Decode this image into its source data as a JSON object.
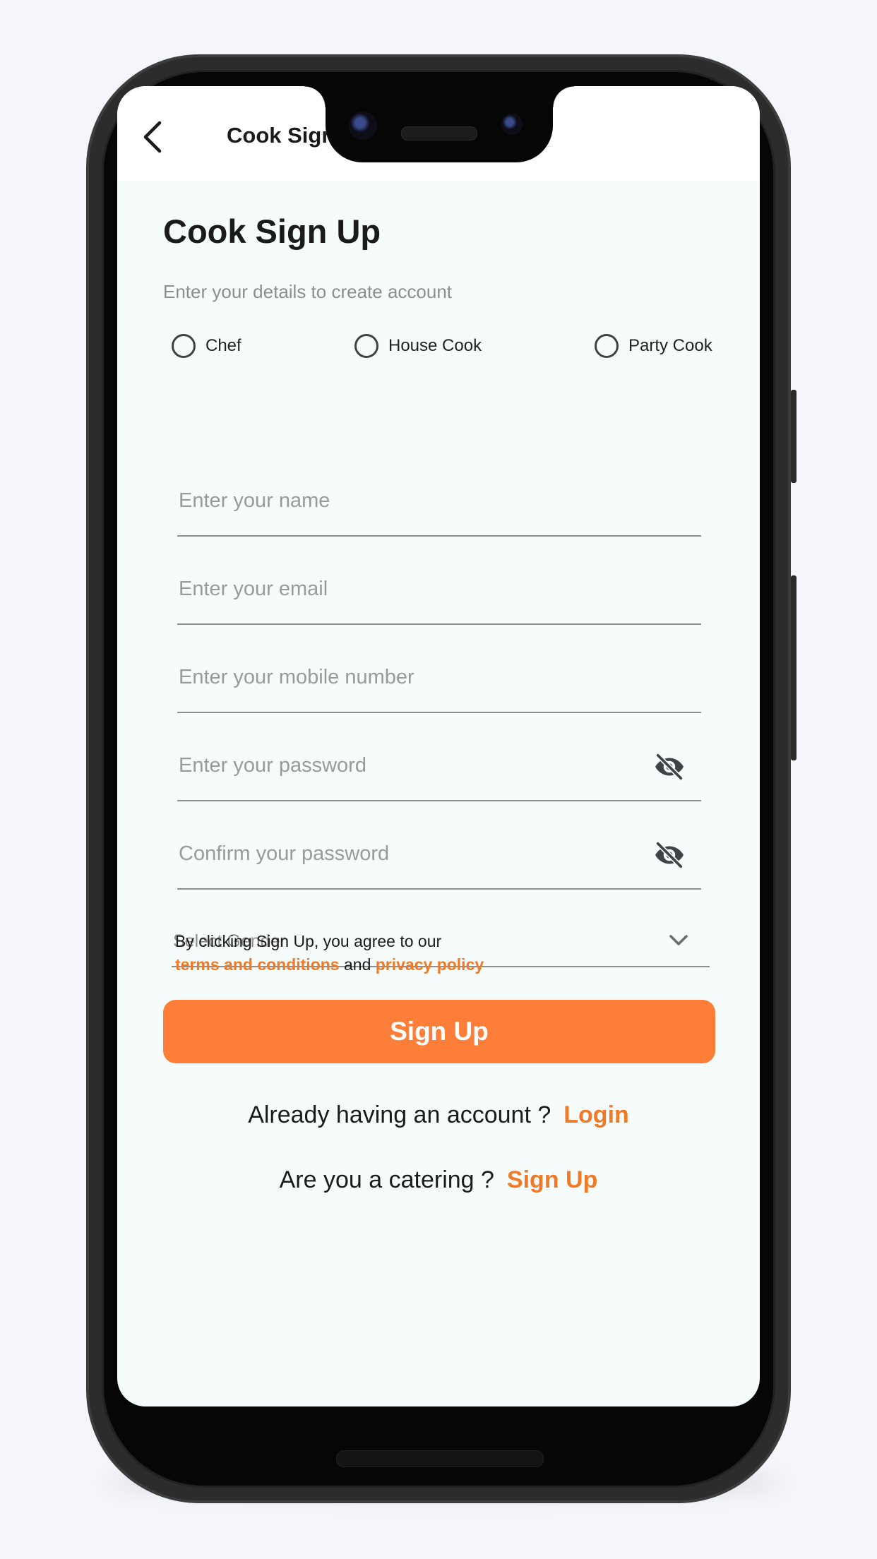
{
  "appbar": {
    "title": "Cook Sign Up",
    "back_icon": "chevron-left-icon"
  },
  "page": {
    "title": "Cook Sign Up",
    "subtitle": "Enter your details to create account"
  },
  "roles": [
    {
      "label": "Chef",
      "selected": false
    },
    {
      "label": "House Cook",
      "selected": false
    },
    {
      "label": "Party Cook",
      "selected": false
    }
  ],
  "fields": {
    "name": {
      "placeholder": "Enter your name",
      "value": ""
    },
    "email": {
      "placeholder": "Enter your email",
      "value": ""
    },
    "mobile": {
      "placeholder": "Enter your mobile number",
      "value": ""
    },
    "password": {
      "placeholder": "Enter your password",
      "value": "",
      "icon": "eye-off-icon"
    },
    "confirm_password": {
      "placeholder": "Confirm your password",
      "value": "",
      "icon": "eye-off-icon"
    }
  },
  "gender": {
    "placeholder": "Select Gender",
    "icon": "chevron-down-icon"
  },
  "terms": {
    "prefix": "By clicking Sign Up, you agree to our",
    "terms_link": "terms and conditions",
    "and": "and",
    "privacy_link": "privacy policy"
  },
  "signup_button": "Sign Up",
  "login_row": {
    "text": "Already having an account ?",
    "link": "Login"
  },
  "catering_row": {
    "text": "Are you a catering ?",
    "link": "Sign Up"
  },
  "colors": {
    "accent": "#fd7e39",
    "link": "#f07a26",
    "background": "#f6fbfc",
    "text": "#1b1b1b",
    "placeholder": "#9a9a9a"
  }
}
